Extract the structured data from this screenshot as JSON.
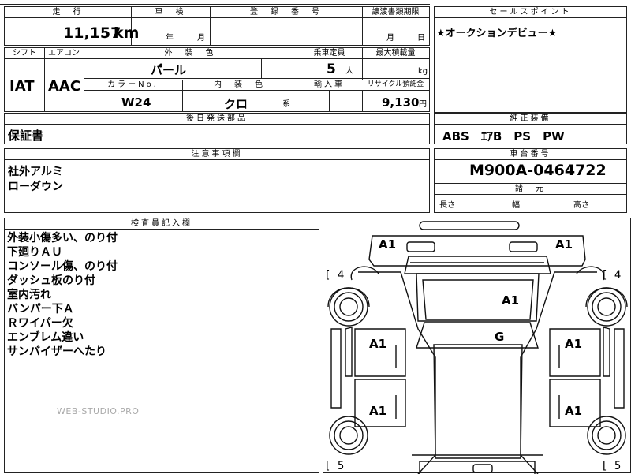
{
  "header": {
    "mileage_label": "走　行",
    "mileage_value": "11,157",
    "mileage_unit": "km",
    "inspection_label": "車　検",
    "inspection_year": "年",
    "inspection_month": "月",
    "registration_label": "登　録　番　号",
    "transfer_label": "譲渡書類期限",
    "transfer_month": "月",
    "transfer_day": "日"
  },
  "sales_point": {
    "label": "セールスポイント",
    "text": "★オークションデビュー★"
  },
  "spec": {
    "shift_label": "シフト",
    "shift_value": "IAT",
    "ac_label": "エアコン",
    "ac_value": "AAC",
    "exterior_label": "外　装　色",
    "exterior_value": "パ゚ール",
    "capacity_label": "乗車定員",
    "capacity_value": "5",
    "capacity_unit": "人",
    "maxload_label": "最大積載量",
    "maxload_unit": "kg",
    "color_no_label": "カラーNo.",
    "color_no_value": "W24",
    "interior_label": "内　装　色",
    "interior_value": "クロ",
    "interior_unit": "系",
    "import_label": "輸入車",
    "recycle_label": "リサイクル預託金",
    "recycle_value": "9,130",
    "recycle_unit": "円"
  },
  "later_parts": {
    "label": "後日発送部品",
    "value": "保証書"
  },
  "equipment": {
    "label": "純正装備",
    "value": "ABS　ｴｱB　PS　PW"
  },
  "caution": {
    "label": "注意事項欄",
    "lines": [
      "社外アルミ",
      "ローダウン"
    ]
  },
  "chassis": {
    "label": "車台番号",
    "value": "M900A-0464722",
    "dims_label": "諸　元",
    "length_label": "長さ",
    "width_label": "幅",
    "height_label": "高さ"
  },
  "inspector": {
    "label": "検査員記入欄",
    "lines": [
      "外装小傷多い、のり付",
      "下廻りＡＵ",
      "コンソール傷、のり付",
      "ダッシュ板のり付",
      "室内汚れ",
      "バンパー下Ａ",
      "Ｒワイパー欠",
      "エンブレム違い",
      "サンバイザーへたり"
    ]
  },
  "diagram": {
    "marks": {
      "front_left": "A1",
      "front_right": "A1",
      "hood": "A1",
      "roof": "G",
      "door_fl": "A1",
      "door_fr": "A1",
      "door_rl": "A1",
      "door_rr": "A1"
    },
    "tires": {
      "fl": "[ 4",
      "fr": "[ 4",
      "rl": "[ 5",
      "rr": "[ 5"
    }
  },
  "watermark": "WEB-STUDIO.PRO"
}
